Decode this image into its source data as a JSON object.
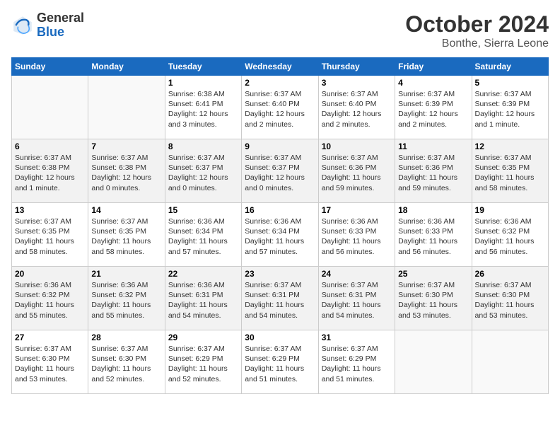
{
  "header": {
    "logo_general": "General",
    "logo_blue": "Blue",
    "month_year": "October 2024",
    "location": "Bonthe, Sierra Leone"
  },
  "columns": [
    "Sunday",
    "Monday",
    "Tuesday",
    "Wednesday",
    "Thursday",
    "Friday",
    "Saturday"
  ],
  "weeks": [
    [
      {
        "day": "",
        "info": ""
      },
      {
        "day": "",
        "info": ""
      },
      {
        "day": "1",
        "info": "Sunrise: 6:38 AM\nSunset: 6:41 PM\nDaylight: 12 hours and 3 minutes."
      },
      {
        "day": "2",
        "info": "Sunrise: 6:37 AM\nSunset: 6:40 PM\nDaylight: 12 hours and 2 minutes."
      },
      {
        "day": "3",
        "info": "Sunrise: 6:37 AM\nSunset: 6:40 PM\nDaylight: 12 hours and 2 minutes."
      },
      {
        "day": "4",
        "info": "Sunrise: 6:37 AM\nSunset: 6:39 PM\nDaylight: 12 hours and 2 minutes."
      },
      {
        "day": "5",
        "info": "Sunrise: 6:37 AM\nSunset: 6:39 PM\nDaylight: 12 hours and 1 minute."
      }
    ],
    [
      {
        "day": "6",
        "info": "Sunrise: 6:37 AM\nSunset: 6:38 PM\nDaylight: 12 hours and 1 minute."
      },
      {
        "day": "7",
        "info": "Sunrise: 6:37 AM\nSunset: 6:38 PM\nDaylight: 12 hours and 0 minutes."
      },
      {
        "day": "8",
        "info": "Sunrise: 6:37 AM\nSunset: 6:37 PM\nDaylight: 12 hours and 0 minutes."
      },
      {
        "day": "9",
        "info": "Sunrise: 6:37 AM\nSunset: 6:37 PM\nDaylight: 12 hours and 0 minutes."
      },
      {
        "day": "10",
        "info": "Sunrise: 6:37 AM\nSunset: 6:36 PM\nDaylight: 11 hours and 59 minutes."
      },
      {
        "day": "11",
        "info": "Sunrise: 6:37 AM\nSunset: 6:36 PM\nDaylight: 11 hours and 59 minutes."
      },
      {
        "day": "12",
        "info": "Sunrise: 6:37 AM\nSunset: 6:35 PM\nDaylight: 11 hours and 58 minutes."
      }
    ],
    [
      {
        "day": "13",
        "info": "Sunrise: 6:37 AM\nSunset: 6:35 PM\nDaylight: 11 hours and 58 minutes."
      },
      {
        "day": "14",
        "info": "Sunrise: 6:37 AM\nSunset: 6:35 PM\nDaylight: 11 hours and 58 minutes."
      },
      {
        "day": "15",
        "info": "Sunrise: 6:36 AM\nSunset: 6:34 PM\nDaylight: 11 hours and 57 minutes."
      },
      {
        "day": "16",
        "info": "Sunrise: 6:36 AM\nSunset: 6:34 PM\nDaylight: 11 hours and 57 minutes."
      },
      {
        "day": "17",
        "info": "Sunrise: 6:36 AM\nSunset: 6:33 PM\nDaylight: 11 hours and 56 minutes."
      },
      {
        "day": "18",
        "info": "Sunrise: 6:36 AM\nSunset: 6:33 PM\nDaylight: 11 hours and 56 minutes."
      },
      {
        "day": "19",
        "info": "Sunrise: 6:36 AM\nSunset: 6:32 PM\nDaylight: 11 hours and 56 minutes."
      }
    ],
    [
      {
        "day": "20",
        "info": "Sunrise: 6:36 AM\nSunset: 6:32 PM\nDaylight: 11 hours and 55 minutes."
      },
      {
        "day": "21",
        "info": "Sunrise: 6:36 AM\nSunset: 6:32 PM\nDaylight: 11 hours and 55 minutes."
      },
      {
        "day": "22",
        "info": "Sunrise: 6:36 AM\nSunset: 6:31 PM\nDaylight: 11 hours and 54 minutes."
      },
      {
        "day": "23",
        "info": "Sunrise: 6:37 AM\nSunset: 6:31 PM\nDaylight: 11 hours and 54 minutes."
      },
      {
        "day": "24",
        "info": "Sunrise: 6:37 AM\nSunset: 6:31 PM\nDaylight: 11 hours and 54 minutes."
      },
      {
        "day": "25",
        "info": "Sunrise: 6:37 AM\nSunset: 6:30 PM\nDaylight: 11 hours and 53 minutes."
      },
      {
        "day": "26",
        "info": "Sunrise: 6:37 AM\nSunset: 6:30 PM\nDaylight: 11 hours and 53 minutes."
      }
    ],
    [
      {
        "day": "27",
        "info": "Sunrise: 6:37 AM\nSunset: 6:30 PM\nDaylight: 11 hours and 53 minutes."
      },
      {
        "day": "28",
        "info": "Sunrise: 6:37 AM\nSunset: 6:30 PM\nDaylight: 11 hours and 52 minutes."
      },
      {
        "day": "29",
        "info": "Sunrise: 6:37 AM\nSunset: 6:29 PM\nDaylight: 11 hours and 52 minutes."
      },
      {
        "day": "30",
        "info": "Sunrise: 6:37 AM\nSunset: 6:29 PM\nDaylight: 11 hours and 51 minutes."
      },
      {
        "day": "31",
        "info": "Sunrise: 6:37 AM\nSunset: 6:29 PM\nDaylight: 11 hours and 51 minutes."
      },
      {
        "day": "",
        "info": ""
      },
      {
        "day": "",
        "info": ""
      }
    ]
  ]
}
